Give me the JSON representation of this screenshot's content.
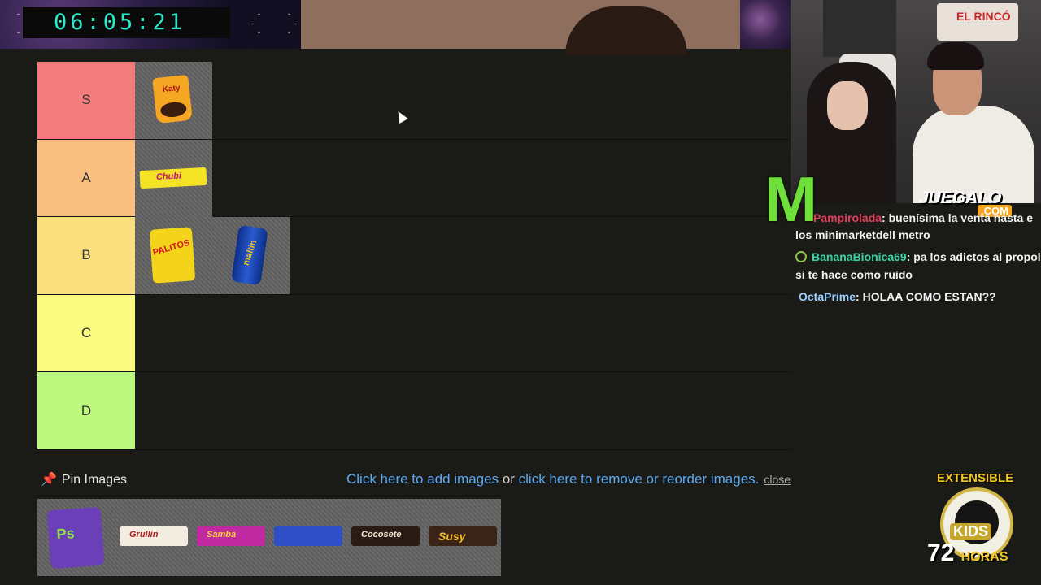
{
  "stream": {
    "timer": "06:05:21"
  },
  "tiers": [
    {
      "label": "S",
      "color": "#f47c7c",
      "items": [
        {
          "icon": "katy-cookie-package",
          "text": "Katy"
        }
      ]
    },
    {
      "label": "A",
      "color": "#f9bf7f",
      "items": [
        {
          "icon": "candy-bar",
          "text": "Chubi"
        }
      ]
    },
    {
      "label": "B",
      "color": "#fadf7f",
      "items": [
        {
          "icon": "palitos-bag",
          "text": "PALITOS"
        },
        {
          "icon": "maltin-can",
          "text": "maltin"
        }
      ]
    },
    {
      "label": "C",
      "color": "#fbfb81",
      "items": []
    },
    {
      "label": "D",
      "color": "#bef97f",
      "items": []
    }
  ],
  "pin_bar": {
    "label": "Pin Images",
    "add_link": "Click here to add images",
    "or_text": " or ",
    "remove_link": "click here to remove or reorder images.",
    "close_link": "close"
  },
  "pool": [
    {
      "icon": "snack-bag",
      "text": "Ps"
    },
    {
      "icon": "candy-bar",
      "text": "Grullin"
    },
    {
      "icon": "candy-bar",
      "text": "Samba"
    },
    {
      "icon": "candy-bar",
      "text": ""
    },
    {
      "icon": "candy-bar",
      "text": "Cocosete"
    },
    {
      "icon": "candy-bar",
      "text": "Susy"
    }
  ],
  "overlay": {
    "poster_text": "EL RINCÓ",
    "sponsor": "JUEGALO",
    "sponsor_sub": ".COM",
    "chat": [
      {
        "user": "Pampirolada",
        "user_color": "#e0405a",
        "message": ": buenísima la venta hasta e",
        "cont": "los minimarketdell metro"
      },
      {
        "user": "BananaBionica69",
        "user_color": "#3ad6a8",
        "message": ": pa los adictos al propol",
        "cont": "si te hace como ruido"
      },
      {
        "user": "OctaPrime",
        "user_color": "#9ad0ff",
        "message": ": HOLAA COMO ESTAN??",
        "cont": ""
      }
    ],
    "logo_top": "EXTENSIBLE",
    "logo_mid": "KIDS",
    "logo_num": "72",
    "logo_hours": "HORAS"
  }
}
